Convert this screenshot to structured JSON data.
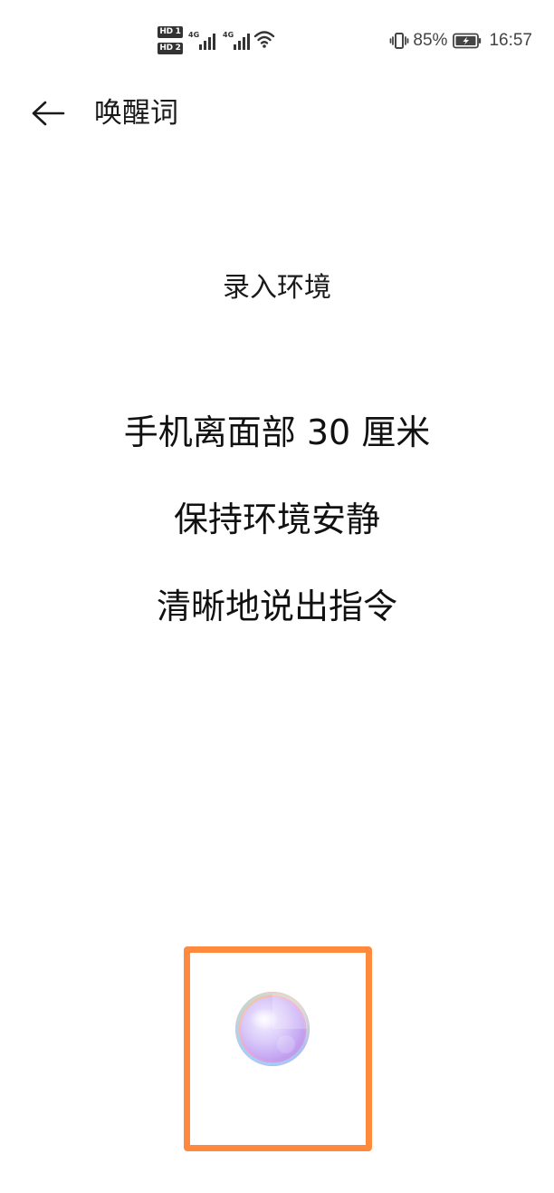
{
  "status_bar": {
    "sim1_badge": "HD 1",
    "sim2_badge": "HD 2",
    "sim1_network": "4G",
    "sim2_network": "4G",
    "battery_percent": "85%",
    "time": "16:57",
    "icons": [
      "signal-icon",
      "wifi-icon",
      "vibrate-icon",
      "battery-charging-icon"
    ]
  },
  "header": {
    "title": "唤醒词",
    "back_icon": "arrow-left-icon"
  },
  "main": {
    "subtitle": "录入环境",
    "instructions": [
      "手机离面部 30 厘米",
      "保持环境安静",
      "清晰地说出指令"
    ]
  },
  "voice_button": {
    "icon": "voice-orb-icon"
  },
  "colors": {
    "background": "#ffffff",
    "text": "#1a1a1a",
    "highlight": "#ff8a3d"
  }
}
